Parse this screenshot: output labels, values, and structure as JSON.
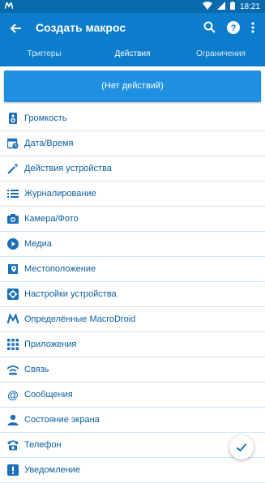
{
  "statusbar": {
    "time": "18:21"
  },
  "appbar": {
    "title": "Создать макрос"
  },
  "tabs": [
    {
      "label": "Триггеры"
    },
    {
      "label": "Действия"
    },
    {
      "label": "Ограничения"
    }
  ],
  "active_tab": "Действия",
  "no_actions_label": "(Нет действий)",
  "categories": [
    {
      "label": "Громкость",
      "icon": "speaker-icon"
    },
    {
      "label": "Дата/Время",
      "icon": "calendar-clock-icon"
    },
    {
      "label": "Действия устройства",
      "icon": "magic-wand-icon"
    },
    {
      "label": "Журналирование",
      "icon": "list-icon"
    },
    {
      "label": "Камера/Фото",
      "icon": "camera-icon"
    },
    {
      "label": "Медиа",
      "icon": "play-icon"
    },
    {
      "label": "Местоположение",
      "icon": "map-pin-icon"
    },
    {
      "label": "Настройки устройства",
      "icon": "settings-icon"
    },
    {
      "label": "Определённые MacroDroid",
      "icon": "macrodroid-icon"
    },
    {
      "label": "Приложения",
      "icon": "apps-grid-icon"
    },
    {
      "label": "Связь",
      "icon": "wifi-icon"
    },
    {
      "label": "Сообщения",
      "icon": "at-icon"
    },
    {
      "label": "Состояние экрана",
      "icon": "person-icon"
    },
    {
      "label": "Телефон",
      "icon": "phone-icon"
    },
    {
      "label": "Уведомление",
      "icon": "notification-icon"
    }
  ],
  "colors": {
    "appbar": "#0c7ccc",
    "statusbar": "#0a6aae",
    "button": "#1e8fe1",
    "list_text": "#0b5e9f"
  }
}
